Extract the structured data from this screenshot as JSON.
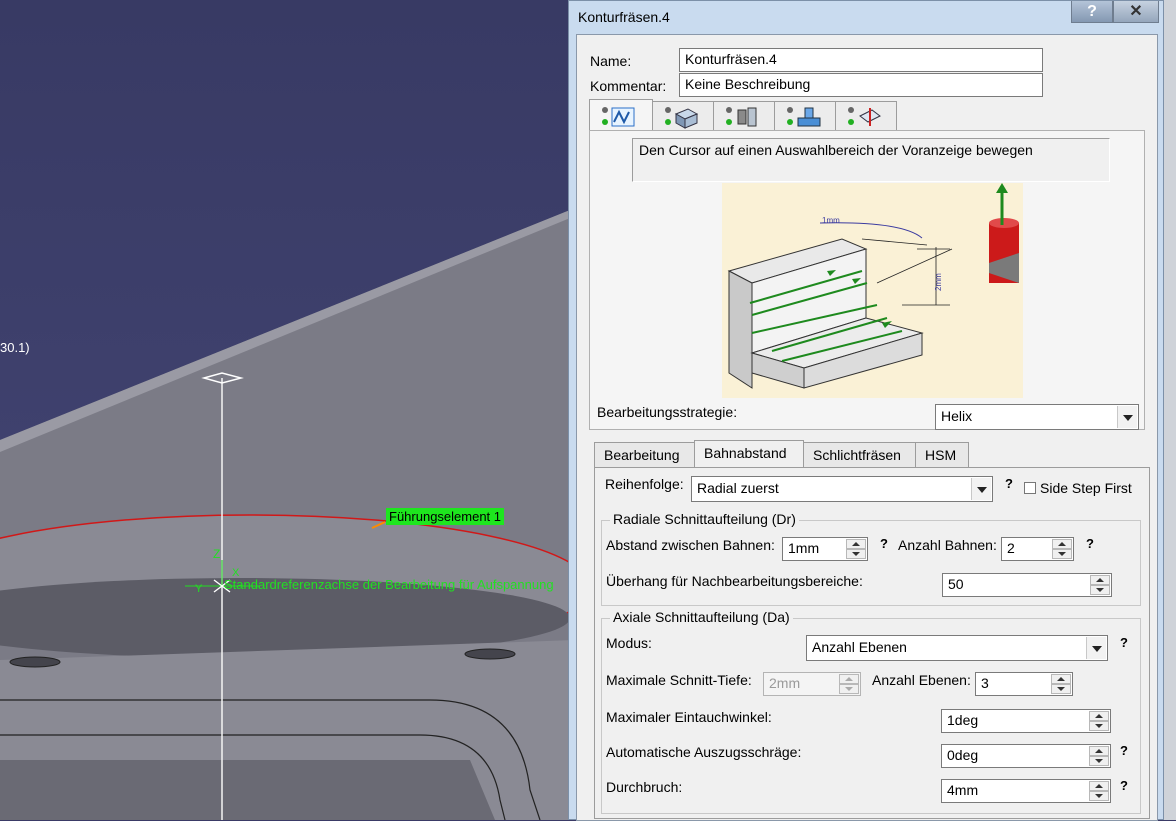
{
  "viewport": {
    "partial_label": "30.1)",
    "guide_label": "Führungselement 1",
    "axis_label": "Standardreferenzachse der Bearbeitung für Aufspannung",
    "axis_z": "Z",
    "axis_x": "X",
    "axis_y": "Y"
  },
  "dialog": {
    "title": "Konturfräsen.4",
    "help_label": "?",
    "close_label": "✕",
    "name_label": "Name:",
    "name_value": "Konturfräsen.4",
    "comment_label": "Kommentar:",
    "comment_value": "Keine Beschreibung",
    "icon_tabs": [
      {
        "icon": "strategy-icon"
      },
      {
        "icon": "geometry-icon"
      },
      {
        "icon": "tool-icon"
      },
      {
        "icon": "feeds-speeds-icon"
      },
      {
        "icon": "macros-icon"
      }
    ],
    "hint": "Den Cursor auf einen Auswahlbereich der Voranzeige bewegen",
    "preview": {
      "dim_1": "1mm",
      "dim_2": "2mm"
    },
    "strategy_label": "Bearbeitungsstrategie:",
    "strategy_value": "Helix",
    "tabs": [
      "Bearbeitung",
      "Bahnabstand",
      "Schlichtfräsen",
      "HSM"
    ],
    "active_tab": "Bahnabstand",
    "order_label": "Reihenfolge:",
    "order_value": "Radial zuerst",
    "side_step_label": "Side Step First",
    "radial": {
      "title": "Radiale Schnittaufteilung (Dr)",
      "distance_label": "Abstand zwischen Bahnen:",
      "distance_value": "1mm",
      "passes_label": "Anzahl Bahnen:",
      "passes_value": "2",
      "overhang_label": "Überhang für Nachbearbeitungsbereiche:",
      "overhang_value": "50"
    },
    "axial": {
      "title": "Axiale Schnittaufteilung (Da)",
      "mode_label": "Modus:",
      "mode_value": "Anzahl Ebenen",
      "max_depth_label": "Maximale Schnitt-Tiefe:",
      "max_depth_value": "2mm",
      "levels_label": "Anzahl Ebenen:",
      "levels_value": "3",
      "plunge_label": "Maximaler Eintauchwinkel:",
      "plunge_value": "1deg",
      "draft_label": "Automatische Auszugsschräge:",
      "draft_value": "0deg",
      "breakthrough_label": "Durchbruch:",
      "breakthrough_value": "4mm"
    },
    "q": "?"
  }
}
